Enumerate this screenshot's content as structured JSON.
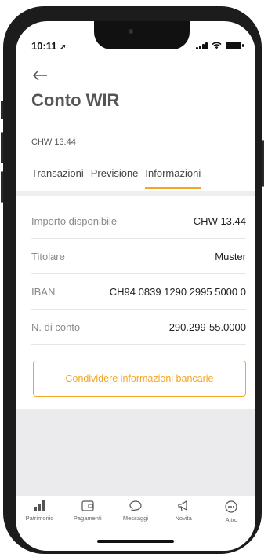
{
  "status": {
    "time": "10:11"
  },
  "header": {
    "title": "Conto WIR",
    "balance": "CHW 13.44"
  },
  "tabs": [
    {
      "label": "Transazioni",
      "active": false
    },
    {
      "label": "Previsione",
      "active": false
    },
    {
      "label": "Informazioni",
      "active": true
    }
  ],
  "info_rows": [
    {
      "label": "Importo disponibile",
      "value": "CHW 13.44"
    },
    {
      "label": "Titolare",
      "value": "Muster"
    },
    {
      "label": "IBAN",
      "value": "CH94 0839 1290 2995 5000 0"
    },
    {
      "label": "N. di conto",
      "value": "290.299-55.0000"
    }
  ],
  "share_button": {
    "label": "Condividere informazioni bancarie"
  },
  "tabbar": [
    {
      "label": "Patrimonio",
      "icon": "bar-chart-icon"
    },
    {
      "label": "Pagamenti",
      "icon": "wallet-icon"
    },
    {
      "label": "Messaggi",
      "icon": "chat-bubble-icon"
    },
    {
      "label": "Novità",
      "icon": "megaphone-icon"
    },
    {
      "label": "Altro",
      "icon": "more-icon"
    }
  ],
  "colors": {
    "accent": "#f5a623",
    "text_muted": "#8a8a8a"
  }
}
